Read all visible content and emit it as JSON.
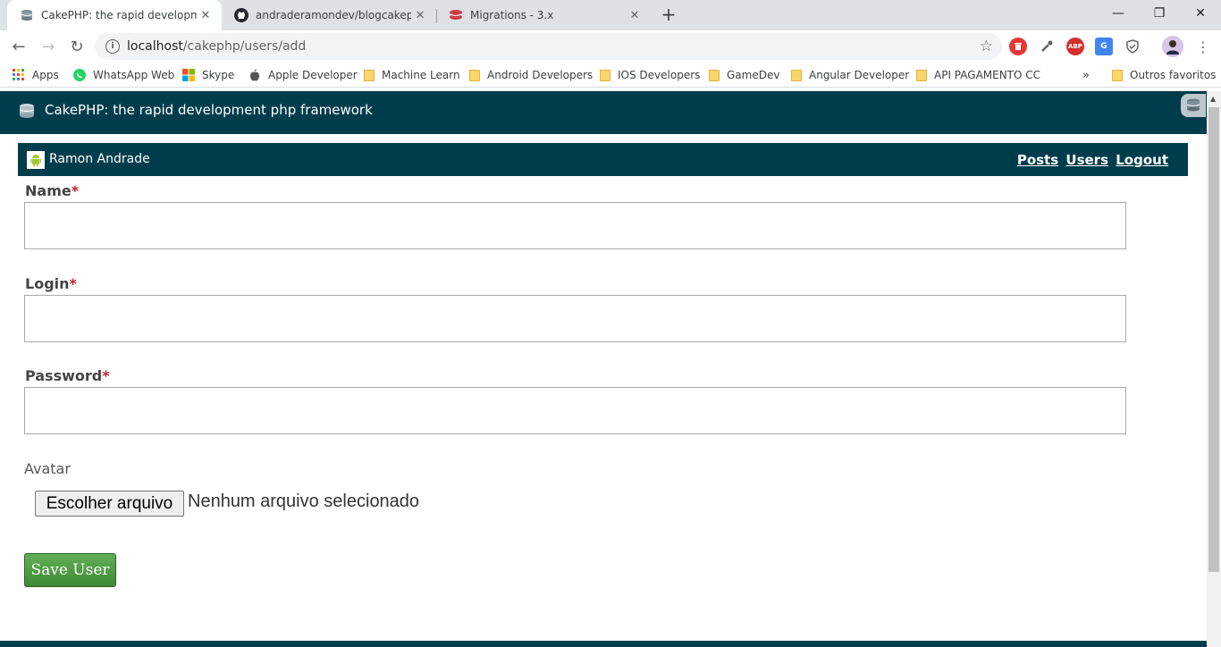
{
  "browser": {
    "tabs": [
      {
        "title": "CakePHP: the rapid development",
        "active": true
      },
      {
        "title": "andraderamondev/blogcakephp",
        "active": false
      },
      {
        "title": "Migrations - 3.x",
        "active": false
      }
    ],
    "url_host": "localhost",
    "url_path": "/cakephp/users/add",
    "bookmarks": [
      {
        "label": "Apps",
        "icon": "apps-grid-icon"
      },
      {
        "label": "WhatsApp Web",
        "icon": "whatsapp-icon"
      },
      {
        "label": "Skype",
        "icon": "windows-logo-icon"
      },
      {
        "label": "Apple Developer",
        "icon": "apple-icon"
      },
      {
        "label": "Machine Learn",
        "icon": "folder-icon"
      },
      {
        "label": "Android Developers",
        "icon": "folder-icon"
      },
      {
        "label": "IOS Developers",
        "icon": "folder-icon"
      },
      {
        "label": "GameDev",
        "icon": "folder-icon"
      },
      {
        "label": "Angular Developer",
        "icon": "folder-icon"
      },
      {
        "label": "API PAGAMENTO CC",
        "icon": "folder-icon"
      }
    ],
    "bookmarks_overflow": "»",
    "other_bookmarks": "Outros favoritos",
    "extensions": [
      {
        "name": "red-badge-extension",
        "text": "",
        "color": "#e53935"
      },
      {
        "name": "eyedropper-extension",
        "text": "",
        "color": "#5f6368"
      },
      {
        "name": "adblock-plus-extension",
        "text": "ABP",
        "color": "#d32f2f"
      },
      {
        "name": "google-translate-extension",
        "text": "G",
        "color": "#4285f4"
      },
      {
        "name": "shield-extension",
        "text": "",
        "color": "#5f6368"
      }
    ]
  },
  "site": {
    "title": "CakePHP: the rapid development php framework",
    "user_name": "Ramon Andrade",
    "nav_links": [
      "Posts",
      "Users",
      "Logout"
    ]
  },
  "form": {
    "fields": [
      {
        "label": "Name",
        "required_mark": "*",
        "value": ""
      },
      {
        "label": "Login",
        "required_mark": "*",
        "value": ""
      },
      {
        "label": "Password",
        "required_mark": "*",
        "value": ""
      }
    ],
    "avatar_label": "Avatar",
    "file_button": "Escolher arquivo",
    "file_status": "Nenhum arquivo selecionado",
    "submit": "Save User"
  },
  "colors": {
    "header_bg": "#003d4c",
    "required": "#c3232d",
    "submit_bg": "#4f9d44"
  }
}
